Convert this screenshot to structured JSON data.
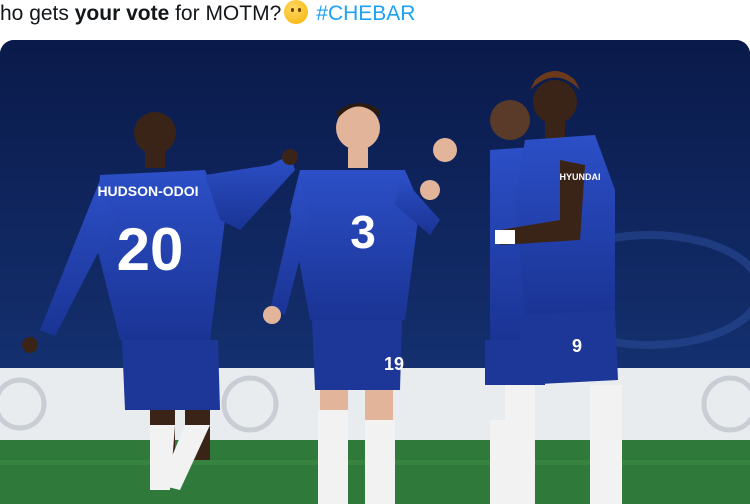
{
  "tweet": {
    "text_before": "ho gets ",
    "text_bold": "your vote",
    "text_after": " for MOTM?",
    "emoji_icon": "thinking-face-icon",
    "hashtag": "#CHEBAR",
    "hashtag_color": "#1da1f2"
  },
  "photo": {
    "player_left_name": "HUDSON-ODOI",
    "player_left_number": "20",
    "player_center_number": "19",
    "player_center_chest": "3",
    "player_right_number": "9",
    "sponsor_text": "HYUNDAI",
    "kit_color": "#1f3fb0",
    "pitch_color": "#2f7a3a"
  }
}
